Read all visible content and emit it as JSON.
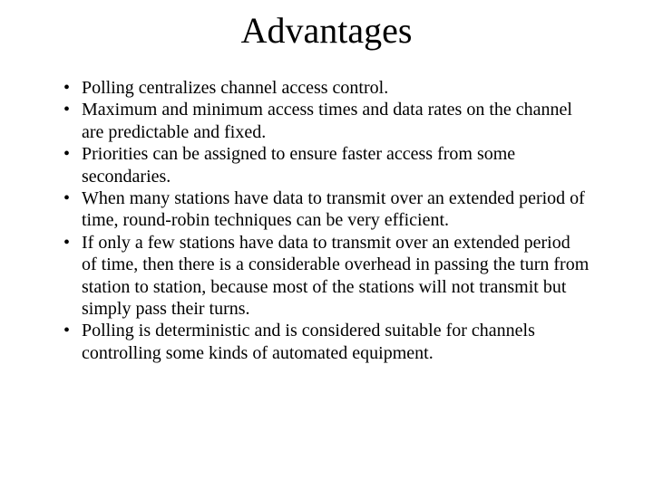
{
  "slide": {
    "title": "Advantages",
    "bullets": [
      "Polling centralizes channel access control.",
      "Maximum and minimum access times and data rates on the channel are predictable and fixed.",
      "Priorities can be assigned to ensure faster access from some secondaries.",
      "When many stations have data to transmit over an extended period of time, round-robin techniques can be very efficient.",
      "If only a few stations have data to transmit over an extended period of time, then there is a considerable overhead in passing the turn from station to station, because most of the stations will  not transmit but simply pass their turns.",
      "Polling is deterministic and is considered suitable for channels controlling some kinds of automated equipment."
    ]
  }
}
